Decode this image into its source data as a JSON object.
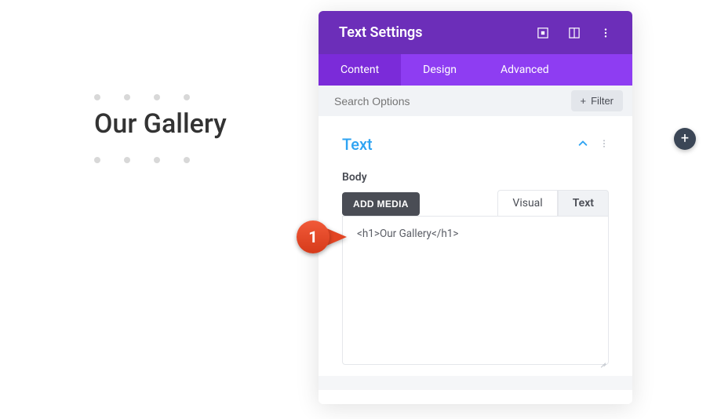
{
  "preview": {
    "heading": "Our Gallery"
  },
  "panel": {
    "title": "Text Settings",
    "tabs": {
      "content": "Content",
      "design": "Design",
      "advanced": "Advanced"
    },
    "search_placeholder": "Search Options",
    "filter_label": "Filter"
  },
  "section": {
    "title": "Text",
    "body_label": "Body",
    "add_media": "ADD MEDIA",
    "editor_tabs": {
      "visual": "Visual",
      "text": "Text"
    },
    "editor_content": "<h1>Our Gallery</h1>"
  },
  "callout": {
    "number": "1"
  },
  "icons": {
    "square": "square-target-icon",
    "columns": "columns-icon",
    "more": "more-vertical-icon",
    "plus": "plus-icon",
    "chevron_up": "chevron-up-icon"
  }
}
